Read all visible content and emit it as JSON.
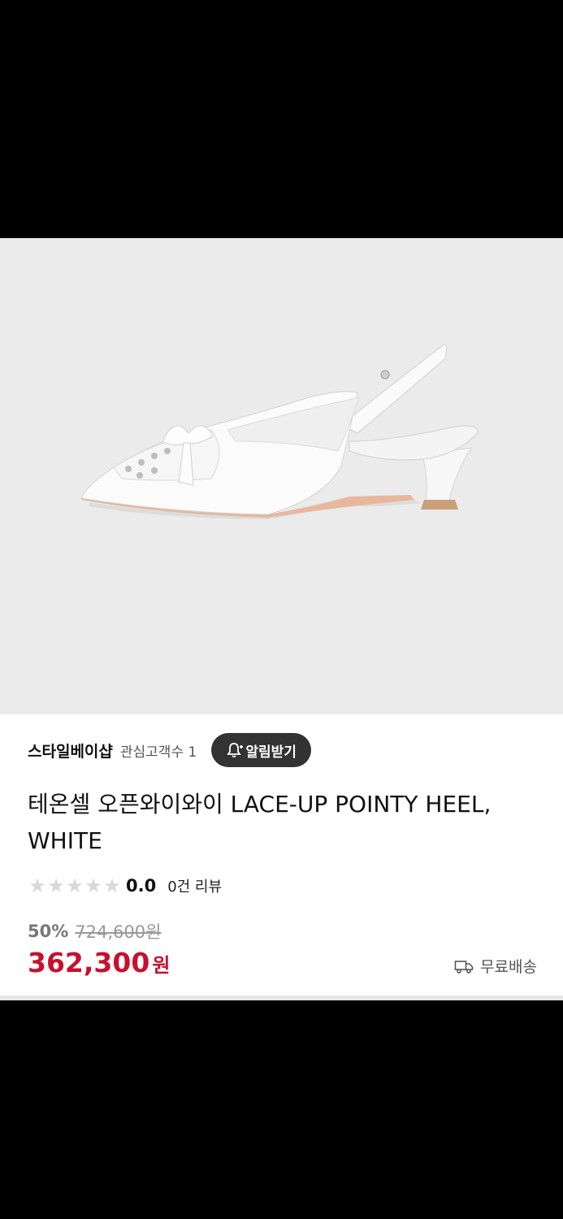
{
  "product_image": {
    "alt": "white lace-up pointy slingback heel"
  },
  "store": {
    "name": "스타일베이샵",
    "followers_label": "관심고객수 1",
    "notify_label": "알림받기"
  },
  "product": {
    "title": "테온셀 오픈와이와이 LACE-UP POINTY HEEL, WHITE"
  },
  "rating": {
    "score": "0.0",
    "reviews": "0건 리뷰",
    "stars_filled": 0,
    "stars_total": 5
  },
  "pricing": {
    "discount": "50%",
    "original": "724,600원",
    "price": "362,300",
    "unit": "원"
  },
  "shipping": {
    "label": "무료배송"
  },
  "colors": {
    "accent_price": "#c8102e",
    "button_bg": "#333333",
    "hero_bg": "#ebebeb"
  }
}
